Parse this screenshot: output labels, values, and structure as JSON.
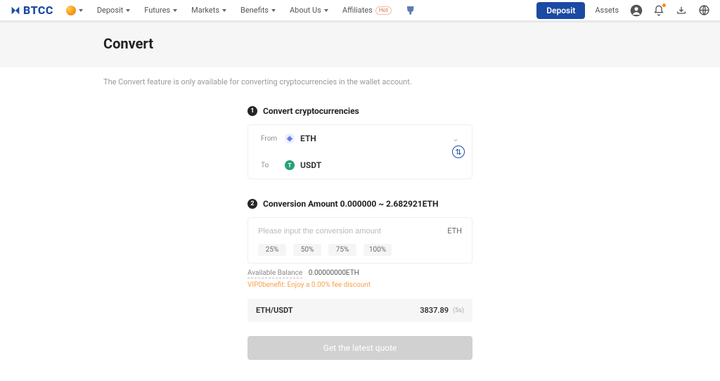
{
  "brand": "BTCC",
  "nav": {
    "items": [
      "Deposit",
      "Futures",
      "Markets",
      "Benefits",
      "About Us",
      "Affiliates"
    ],
    "hot_tag": "Hot"
  },
  "header": {
    "deposit_btn": "Deposit",
    "assets": "Assets"
  },
  "page": {
    "title": "Convert",
    "desc": "The Convert feature is only available for converting cryptocurrencies in the wallet account."
  },
  "step1": {
    "title": "Convert cryptocurrencies",
    "from_label": "From",
    "to_label": "To",
    "from_coin": "ETH",
    "to_coin": "USDT"
  },
  "step2": {
    "title": "Conversion Amount 0.000000 ~ 2.682921ETH",
    "placeholder": "Please input the conversion amount",
    "unit": "ETH",
    "pcts": [
      "25%",
      "50%",
      "75%",
      "100%"
    ],
    "avail_label": "Available Balance",
    "avail_value": "0.00000000ETH",
    "vip_text": "VIP0benefit: Enjoy a 0.00% fee discount",
    "rate_pair": "ETH/USDT",
    "rate_value": "3837.89",
    "rate_refresh": "(5s)",
    "quote_btn": "Get the latest quote"
  }
}
